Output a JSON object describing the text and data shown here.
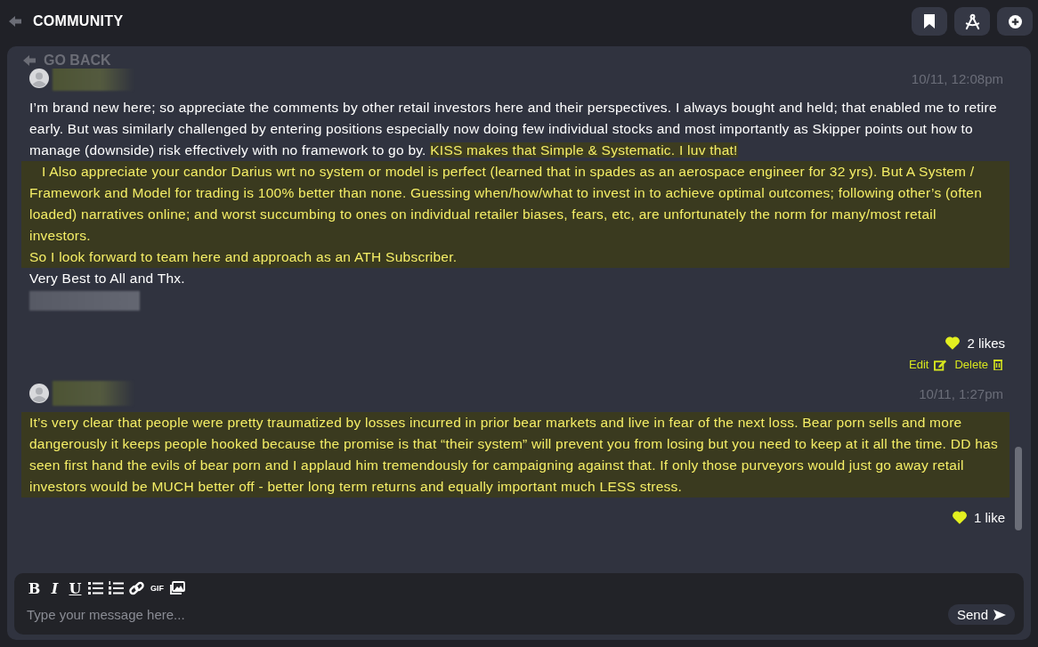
{
  "header": {
    "title": "COMMUNITY"
  },
  "back_link": "GO BACK",
  "posts": [
    {
      "timestamp": "10/11, 12:08pm",
      "liked": true,
      "likes": "2 likes",
      "actions": [
        {
          "kind": "edit",
          "label": "Edit"
        },
        {
          "kind": "delete",
          "label": "Delete"
        }
      ],
      "body": [
        {
          "kind": "paragraph",
          "runs": [
            {
              "text": "I’m brand new here; so appreciate the comments by other retail investors here and their perspectives. I always bought and held; that enabled me to retire early. But was similarly challenged by entering positions especially now doing few individual stocks and most importantly as Skipper points out how to manage (downside) risk effectively with no framework to go by.",
              "highlighted": false
            },
            {
              "text": "KISS makes that Simple & Systematic. I luv that!",
              "highlighted": true
            }
          ]
        },
        {
          "kind": "highlight_block",
          "lines": [
            "I Also appreciate your candor Darius wrt no system or model is perfect (learned that in spades as an aerospace engineer for 32 yrs). But A System / Framework and Model for trading is 100% better than none. Guessing when/how/what to invest in to achieve optimal outcomes; following other’s (often loaded) narratives online; and worst succumbing to ones on individual retailer biases, fears, etc, are unfortunately the norm for many/most retail investors.",
            "So I look forward to team here and approach as an ATH Subscriber."
          ]
        },
        {
          "kind": "paragraph",
          "runs": [
            {
              "text": "Very Best to All and Thx.",
              "highlighted": false
            }
          ]
        },
        {
          "kind": "redacted"
        }
      ]
    },
    {
      "timestamp": "10/11, 1:27pm",
      "liked": true,
      "likes": "1 like",
      "body": [
        {
          "kind": "highlight_block",
          "lines": [
            "It’s very clear that people were pretty traumatized by losses incurred in prior bear markets and live in fear of the next loss.  Bear porn sells and more dangerously it keeps people hooked because the promise is that “their system” will prevent you from losing but you need to keep at it all the time.  DD has seen first hand the evils of bear porn and I applaud him tremendously for campaigning against that.  If only those purveyors would just go away retail investors would be MUCH better off - better long term returns and equally important much LESS stress."
          ]
        }
      ]
    }
  ],
  "composer": {
    "toolbar": [
      {
        "kind": "bold",
        "label": "B"
      },
      {
        "kind": "italic",
        "label": "I"
      },
      {
        "kind": "underline",
        "label": "U"
      },
      {
        "kind": "bullets"
      },
      {
        "kind": "numbers"
      },
      {
        "kind": "link"
      },
      {
        "kind": "gif",
        "label": "GIF"
      },
      {
        "kind": "image"
      }
    ],
    "placeholder": "Type your message here...",
    "send": "Send"
  }
}
